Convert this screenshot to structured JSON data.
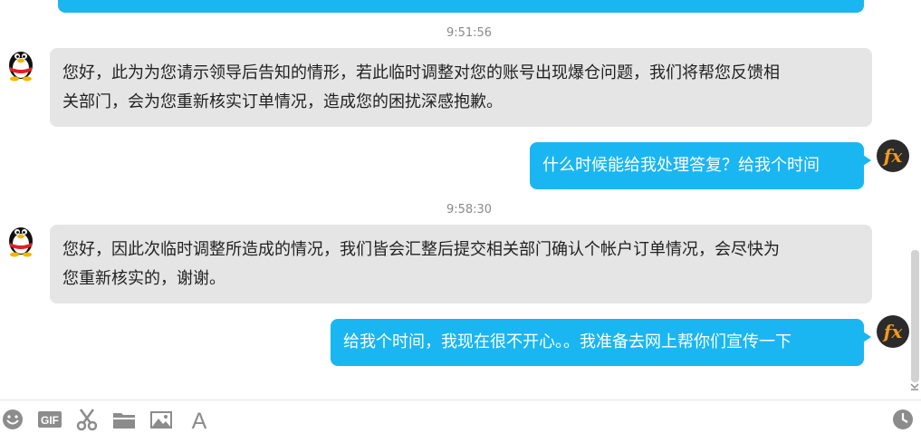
{
  "conversation": {
    "messages": [
      {
        "type": "partial_outgoing_bubble"
      },
      {
        "type": "timestamp",
        "text": "9:51:56"
      },
      {
        "type": "incoming",
        "avatar": "qq-penguin-icon",
        "lines": [
          "您好，此为为您请示领导后告知的情形，若此临时调整对您的账号出现爆仓问题，我们将帮您反馈相",
          "关部门，会为您重新核实订单情况，造成您的困扰深感抱歉。"
        ]
      },
      {
        "type": "outgoing",
        "avatar": "fx-logo-icon",
        "lines": [
          "什么时候能给我处理答复？给我个时间"
        ]
      },
      {
        "type": "timestamp",
        "text": "9:58:30"
      },
      {
        "type": "incoming",
        "avatar": "qq-penguin-icon",
        "lines": [
          "您好，因此次临时调整所造成的情况，我们皆会汇整后提交相关部门确认个帐户订单情况，会尽快为",
          "您重新核实的，谢谢。"
        ]
      },
      {
        "type": "outgoing",
        "avatar": "fx-logo-icon",
        "lines": [
          "给我个时间，我现在很不开心。。我准备去网上帮你们宣传一下"
        ]
      }
    ]
  },
  "toolbar": {
    "left_icons": [
      "emoji-icon",
      "gif-icon",
      "scissors-icon",
      "folder-icon",
      "image-icon",
      "font-icon"
    ],
    "gif_label": "GIF",
    "font_label": "A",
    "right_icon": "history-clock-icon"
  },
  "colors": {
    "incoming_bubble": "#e5e5e5",
    "outgoing_bubble": "#1ab6f2",
    "timestamp_text": "#8a8a8a",
    "toolbar_icon": "#8c8c8c"
  }
}
